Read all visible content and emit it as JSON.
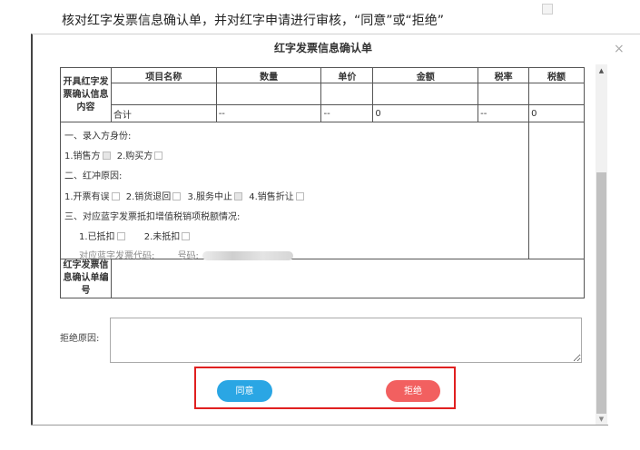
{
  "instruction": "核对红字发票信息确认单，并对红字申请进行审核，“同意”或“拒绝”",
  "dialog": {
    "title": "红字发票信息确认单",
    "close_symbol": "×"
  },
  "table": {
    "section_label": "开具红字发票确认信息内容",
    "headers": [
      "项目名称",
      "数量",
      "单价",
      "金额",
      "税率",
      "税额"
    ],
    "total_row": [
      "合计",
      "--",
      "--",
      "0",
      "--",
      "0"
    ],
    "number_label": "红字发票信息确认单编号"
  },
  "info": {
    "entry_title": "一、录入方身份:",
    "entry_options": [
      {
        "label": "1.销售方",
        "checked": true
      },
      {
        "label": "2.购买方",
        "checked": false
      }
    ],
    "reason_title": "二、红冲原因:",
    "reason_options": [
      {
        "label": "1.开票有误",
        "checked": false
      },
      {
        "label": "2.销货退回",
        "checked": false
      },
      {
        "label": "3.服务中止",
        "checked": true
      },
      {
        "label": "4.销售折让",
        "checked": false
      }
    ],
    "deduct_title": "三、对应蓝字发票抵扣增值税销项税额情况:",
    "deduct_options": [
      {
        "label": "1.已抵扣",
        "checked": false
      },
      {
        "label": "2.未抵扣",
        "checked": false
      }
    ],
    "blue_code_label": "对应蓝字发票代码:",
    "number_label": "号码:"
  },
  "reject": {
    "label": "拒绝原因:",
    "value": ""
  },
  "buttons": {
    "agree": "同意",
    "reject": "拒绝"
  },
  "colors": {
    "agree": "#2aa6e4",
    "reject": "#f26060",
    "highlight": "#e02020"
  }
}
